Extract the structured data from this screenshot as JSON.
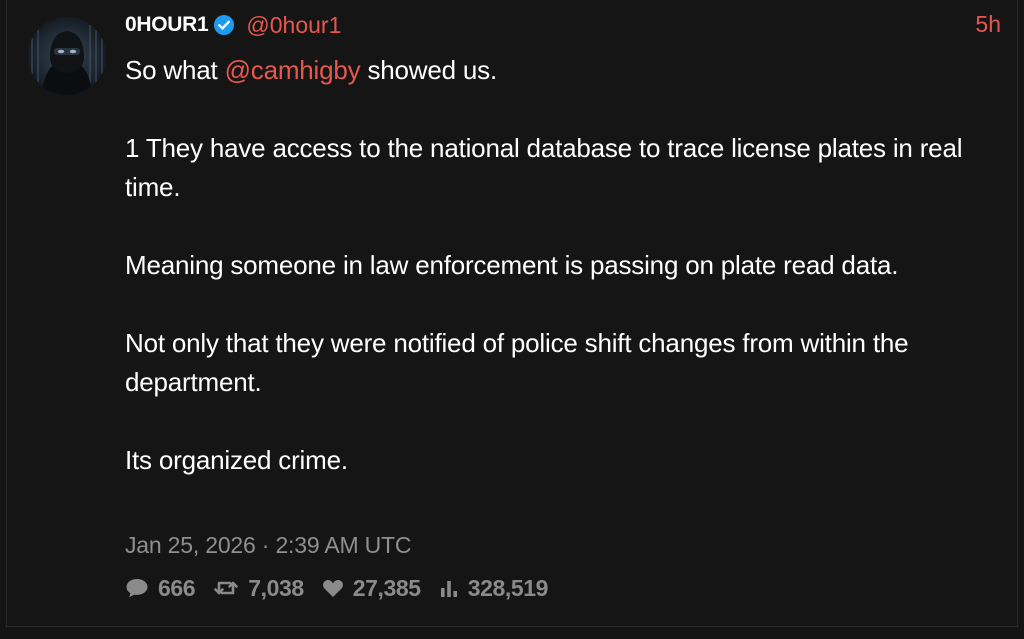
{
  "tweet": {
    "author": {
      "display_name": "0HOUR1",
      "verified": true,
      "handle": "@0hour1"
    },
    "time_ago": "5h",
    "body": {
      "line1_prefix": "So what ",
      "line1_mention": "@camhigby",
      "line1_suffix": " showed us.",
      "para2": "1 They have access to the national database to trace license plates in real time.",
      "para3": "Meaning someone in law enforcement is passing on plate read data.",
      "para4": "Not only that they were notified of police shift changes from within the department.",
      "para5": "Its organized crime."
    },
    "timestamp": "Jan 25, 2026 · 2:39 AM UTC",
    "stats": {
      "replies": "666",
      "retweets": "7,038",
      "likes": "27,385",
      "views": "328,519"
    }
  },
  "colors": {
    "background": "#151515",
    "accent": "#e8574d",
    "text": "#ffffff",
    "muted": "#8a8a8a",
    "verified_badge": "#1d9bf0"
  },
  "icons": {
    "verified": "verified-badge-icon",
    "replies": "comment-icon",
    "retweets": "retweet-icon",
    "likes": "heart-icon",
    "views": "bar-chart-icon"
  }
}
